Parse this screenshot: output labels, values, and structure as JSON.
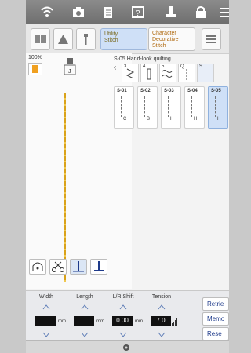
{
  "mode_buttons": [
    {
      "label": "Utility\nStitch"
    },
    {
      "label": "Character\nDecorative\nStitch"
    }
  ],
  "preview": {
    "zoom": "100%"
  },
  "pattern_title": "S-05  Hand-look quilting",
  "category_numbers": [
    "3",
    "4",
    "5",
    "Q",
    "S"
  ],
  "patterns": [
    {
      "code": "S-01",
      "sub": "C"
    },
    {
      "code": "S-02",
      "sub": "B"
    },
    {
      "code": "S-03",
      "sub": "H"
    },
    {
      "code": "S-04",
      "sub": "H"
    },
    {
      "code": "S-05",
      "sub": "H"
    }
  ],
  "settings": [
    {
      "label": "Width",
      "value": "",
      "unit": "mm"
    },
    {
      "label": "Length",
      "value": "",
      "unit": "mm"
    },
    {
      "label": "L/R Shift",
      "value": "0.00",
      "unit": "mm"
    },
    {
      "label": "Tension",
      "value": "7.0",
      "unit": ""
    }
  ],
  "side_buttons": [
    {
      "label": "Retrie"
    },
    {
      "label": "Memo"
    },
    {
      "label": "Rese"
    }
  ]
}
